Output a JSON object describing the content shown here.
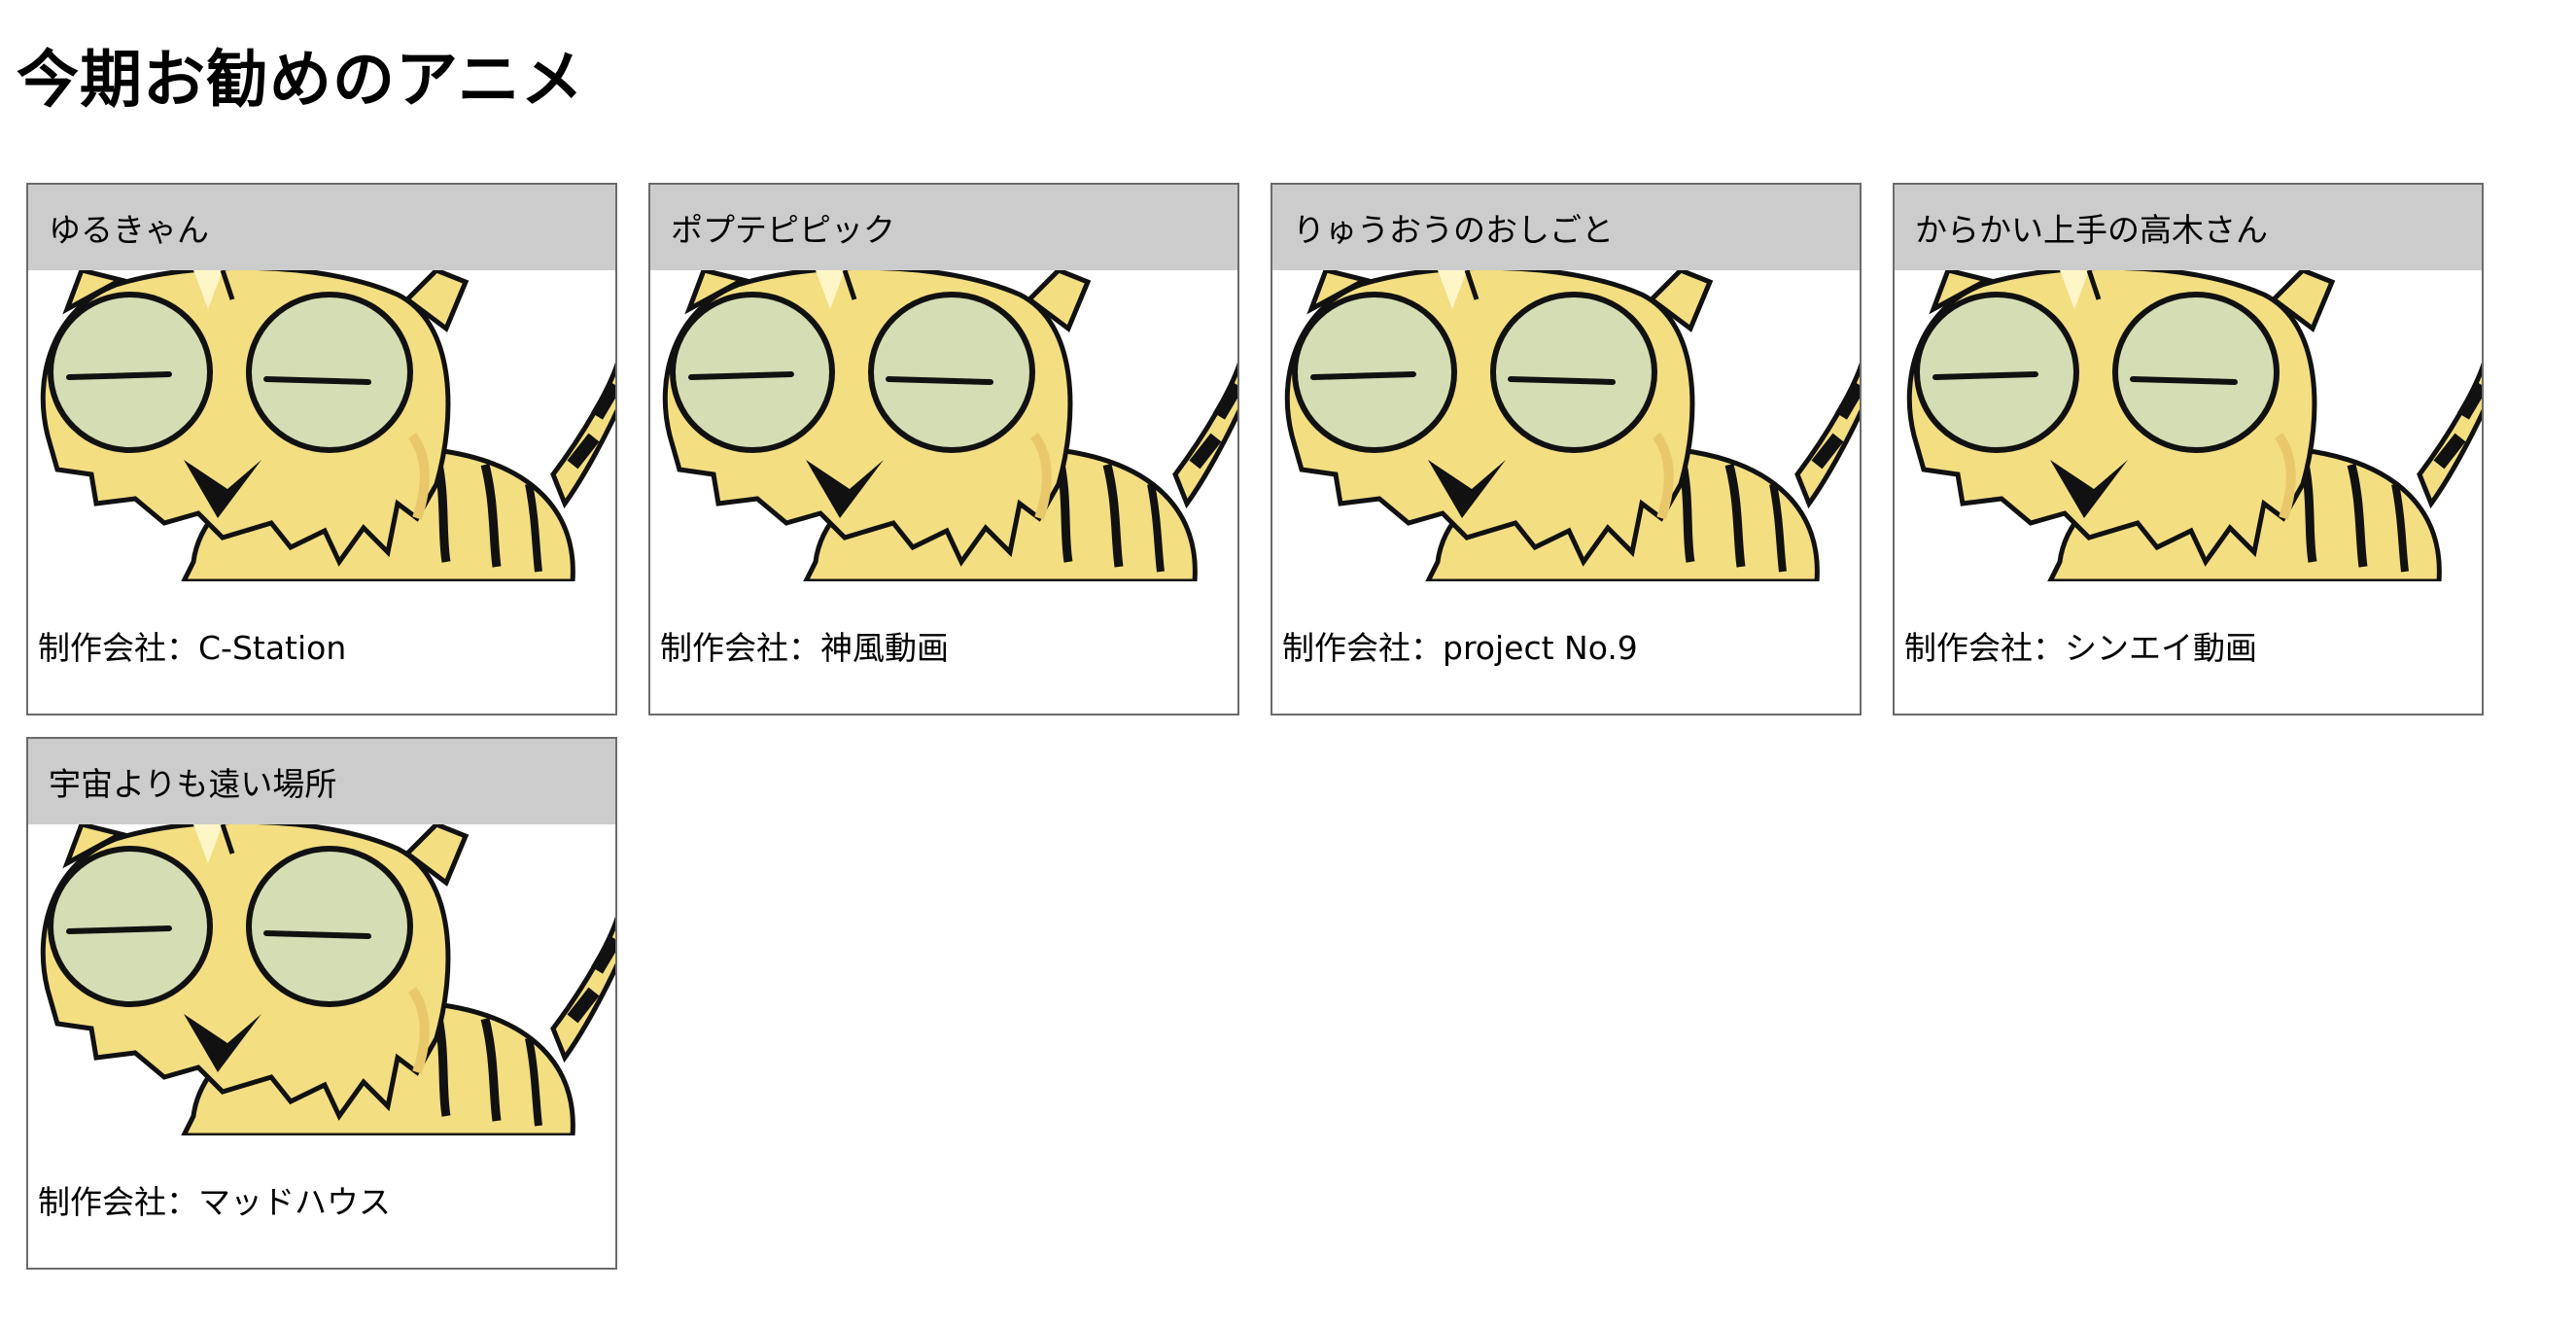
{
  "page": {
    "title": "今期お勧めのアニメ"
  },
  "cards": [
    {
      "title": "ゆるきゃん",
      "studio": "制作会社：C-Station"
    },
    {
      "title": "ポプテピピック",
      "studio": "制作会社：神風動画"
    },
    {
      "title": "りゅうおうのおしごと",
      "studio": "制作会社：project No.9"
    },
    {
      "title": "からかい上手の高木さん",
      "studio": "制作会社：シンエイ動画"
    },
    {
      "title": "宇宙よりも遠い場所",
      "studio": "制作会社：マッドハウス"
    }
  ],
  "image": {
    "icon": "tiger-illustration",
    "colors": {
      "body": "#F3DE82",
      "eyes": "#D4DDB4",
      "outline": "#111111",
      "shade": "#E8C86A"
    }
  }
}
